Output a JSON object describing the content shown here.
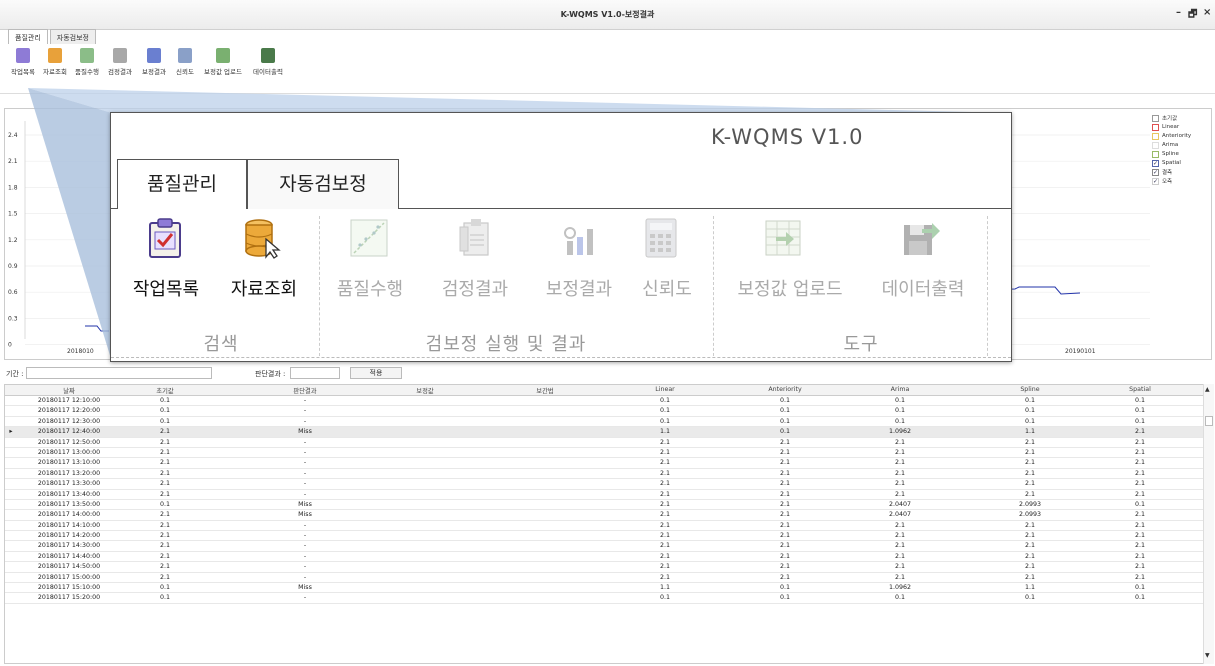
{
  "window": {
    "title": "K-WQMS V1.0-보정결과",
    "minimize": "–",
    "restore": "🗗",
    "close": "×"
  },
  "top_tabs": [
    {
      "label": "품질관리"
    },
    {
      "label": "자동검보정"
    }
  ],
  "ribbon_small": [
    {
      "label": "작업목록",
      "color": "#8e7bd6"
    },
    {
      "label": "자료조회",
      "color": "#e8a13a"
    },
    {
      "label": "품질수행",
      "color": "#8bbd88"
    },
    {
      "label": "검정결과",
      "color": "#a8a8a8"
    },
    {
      "label": "보정결과",
      "color": "#6a7fd0"
    },
    {
      "label": "신뢰도",
      "color": "#8aa0c8"
    },
    {
      "label": "보정값 업로드",
      "color": "#7ab070"
    },
    {
      "label": "데이터출력",
      "color": "#4a7a4a"
    }
  ],
  "chart": {
    "y_ticks": [
      "2.4",
      "2.1",
      "1.8",
      "1.5",
      "1.2",
      "0.9",
      "0.6",
      "0.3",
      "0"
    ],
    "x_ticks": [
      "2018010",
      "20190101"
    ],
    "line_color": "#2233aa"
  },
  "legend": [
    {
      "label": "초기값",
      "checked": false,
      "color": "#999999"
    },
    {
      "label": "Linear",
      "checked": false,
      "color": "#e05050"
    },
    {
      "label": "Anteriority",
      "checked": false,
      "color": "#e8c860"
    },
    {
      "label": "Arima",
      "checked": false,
      "color": "#dddddd"
    },
    {
      "label": "Spline",
      "checked": false,
      "color": "#99bb66"
    },
    {
      "label": "Spatial",
      "checked": true,
      "color": "#5566aa"
    },
    {
      "label": "결측",
      "checked": true,
      "color": "#888888"
    },
    {
      "label": "오측",
      "checked": true,
      "color": "#cccccc"
    }
  ],
  "filter": {
    "period_label": "기간 :",
    "result_label": "판단결과 :",
    "apply_label": "적용"
  },
  "table": {
    "columns": [
      "날짜",
      "초기값",
      "판단결과",
      "보정값",
      "보간법",
      "Linear",
      "Anteriority",
      "Arima",
      "Spline",
      "Spatial"
    ],
    "rows": [
      [
        "20180117 12:10:00",
        "0.1",
        "-",
        "",
        "",
        "0.1",
        "0.1",
        "0.1",
        "0.1",
        "0.1"
      ],
      [
        "20180117 12:20:00",
        "0.1",
        "-",
        "",
        "",
        "0.1",
        "0.1",
        "0.1",
        "0.1",
        "0.1"
      ],
      [
        "20180117 12:30:00",
        "0.1",
        "-",
        "",
        "",
        "0.1",
        "0.1",
        "0.1",
        "0.1",
        "0.1"
      ],
      [
        "20180117 12:40:00",
        "2.1",
        "Miss",
        "",
        "",
        "1.1",
        "0.1",
        "1.0962",
        "1.1",
        "2.1"
      ],
      [
        "20180117 12:50:00",
        "2.1",
        "-",
        "",
        "",
        "2.1",
        "2.1",
        "2.1",
        "2.1",
        "2.1"
      ],
      [
        "20180117 13:00:00",
        "2.1",
        "-",
        "",
        "",
        "2.1",
        "2.1",
        "2.1",
        "2.1",
        "2.1"
      ],
      [
        "20180117 13:10:00",
        "2.1",
        "-",
        "",
        "",
        "2.1",
        "2.1",
        "2.1",
        "2.1",
        "2.1"
      ],
      [
        "20180117 13:20:00",
        "2.1",
        "-",
        "",
        "",
        "2.1",
        "2.1",
        "2.1",
        "2.1",
        "2.1"
      ],
      [
        "20180117 13:30:00",
        "2.1",
        "-",
        "",
        "",
        "2.1",
        "2.1",
        "2.1",
        "2.1",
        "2.1"
      ],
      [
        "20180117 13:40:00",
        "2.1",
        "-",
        "",
        "",
        "2.1",
        "2.1",
        "2.1",
        "2.1",
        "2.1"
      ],
      [
        "20180117 13:50:00",
        "0.1",
        "Miss",
        "",
        "",
        "2.1",
        "2.1",
        "2.0407",
        "2.0993",
        "0.1"
      ],
      [
        "20180117 14:00:00",
        "2.1",
        "Miss",
        "",
        "",
        "2.1",
        "2.1",
        "2.0407",
        "2.0993",
        "2.1"
      ],
      [
        "20180117 14:10:00",
        "2.1",
        "-",
        "",
        "",
        "2.1",
        "2.1",
        "2.1",
        "2.1",
        "2.1"
      ],
      [
        "20180117 14:20:00",
        "2.1",
        "-",
        "",
        "",
        "2.1",
        "2.1",
        "2.1",
        "2.1",
        "2.1"
      ],
      [
        "20180117 14:30:00",
        "2.1",
        "-",
        "",
        "",
        "2.1",
        "2.1",
        "2.1",
        "2.1",
        "2.1"
      ],
      [
        "20180117 14:40:00",
        "2.1",
        "-",
        "",
        "",
        "2.1",
        "2.1",
        "2.1",
        "2.1",
        "2.1"
      ],
      [
        "20180117 14:50:00",
        "2.1",
        "-",
        "",
        "",
        "2.1",
        "2.1",
        "2.1",
        "2.1",
        "2.1"
      ],
      [
        "20180117 15:00:00",
        "2.1",
        "-",
        "",
        "",
        "2.1",
        "2.1",
        "2.1",
        "2.1",
        "2.1"
      ],
      [
        "20180117 15:10:00",
        "0.1",
        "Miss",
        "",
        "",
        "1.1",
        "0.1",
        "1.0962",
        "1.1",
        "0.1"
      ],
      [
        "20180117 15:20:00",
        "0.1",
        "-",
        "",
        "",
        "0.1",
        "0.1",
        "0.1",
        "0.1",
        "0.1"
      ]
    ],
    "selected_row": 3
  },
  "zoom": {
    "title": "K-WQMS V1.0",
    "tabs": [
      {
        "label": "품질관리"
      },
      {
        "label": "자동검보정"
      }
    ],
    "items": [
      {
        "label": "작업목록",
        "enabled": true
      },
      {
        "label": "자료조회",
        "enabled": true
      },
      {
        "label": "품질수행",
        "enabled": false
      },
      {
        "label": "검정결과",
        "enabled": false
      },
      {
        "label": "보정결과",
        "enabled": false
      },
      {
        "label": "신뢰도",
        "enabled": false
      },
      {
        "label": "보정값 업로드",
        "enabled": false
      },
      {
        "label": "데이터출력",
        "enabled": false
      }
    ],
    "groups": [
      {
        "label": "검색"
      },
      {
        "label": "검보정 실행 및 결과"
      },
      {
        "label": "도구"
      }
    ]
  }
}
